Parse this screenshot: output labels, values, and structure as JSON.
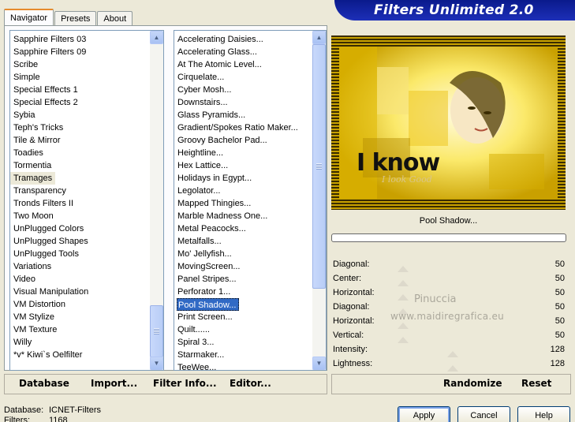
{
  "tabs": [
    "Navigator",
    "Presets",
    "About"
  ],
  "app_title": "Filters Unlimited 2.0",
  "categories": [
    "Sapphire Filters 03",
    "Sapphire Filters 09",
    "Scribe",
    "Simple",
    "Special Effects 1",
    "Special Effects 2",
    "Sybia",
    "Teph's Tricks",
    "Tile & Mirror",
    "Toadies",
    "Tormentia",
    "Tramages",
    "Transparency",
    "Tronds Filters II",
    "Two Moon",
    "UnPlugged Colors",
    "UnPlugged Shapes",
    "UnPlugged Tools",
    "Variations",
    "Video",
    "Visual Manipulation",
    "VM Distortion",
    "VM Stylize",
    "VM Texture",
    "Willy",
    "*v* Kiwi`s Oelfilter"
  ],
  "selected_category": "Tramages",
  "filters": [
    "Accelerating Daisies...",
    "Accelerating Glass...",
    "At The Atomic Level...",
    "Cirquelate...",
    "Cyber Mosh...",
    "Downstairs...",
    "Glass Pyramids...",
    "Gradient/Spokes Ratio Maker...",
    "Groovy Bachelor Pad...",
    "Heightline...",
    "Hex Lattice...",
    "Holidays in Egypt...",
    "Legolator...",
    "Mapped Thingies...",
    "Marble Madness One...",
    "Metal Peacocks...",
    "Metalfalls...",
    "Mo' Jellyfish...",
    "MovingScreen...",
    "Panel Stripes...",
    "Perforator 1...",
    "Pool Shadow...",
    "Print Screen...",
    "Quilt......",
    "Spiral 3...",
    "Starmaker...",
    "TeeWee..."
  ],
  "selected_filter": "Pool Shadow...",
  "toolbar": {
    "database": "Database",
    "import": "Import...",
    "filter_info": "Filter Info...",
    "editor": "Editor...",
    "randomize": "Randomize",
    "reset": "Reset"
  },
  "preview": {
    "filter_name": "Pool Shadow...",
    "image_text": "I know",
    "image_subtext": "I look Good"
  },
  "progress": 0,
  "params": [
    {
      "label": "Diagonal:",
      "value": "50"
    },
    {
      "label": "Center:",
      "value": "50"
    },
    {
      "label": "Horizontal:",
      "value": "50"
    },
    {
      "label": "Diagonal:",
      "value": "50"
    },
    {
      "label": "Horizontal:",
      "value": "50"
    },
    {
      "label": "Vertical:",
      "value": "50"
    },
    {
      "label": "Intensity:",
      "value": "128"
    },
    {
      "label": "Lightness:",
      "value": "128"
    }
  ],
  "watermark": {
    "line1": "Pinuccia",
    "line2": "www.maidiregrafica.eu"
  },
  "footer": {
    "database_label": "Database:",
    "database_value": "ICNET-Filters",
    "filters_label": "Filters:",
    "filters_value": "1168"
  },
  "buttons": {
    "apply": "Apply",
    "cancel": "Cancel",
    "help": "Help"
  }
}
